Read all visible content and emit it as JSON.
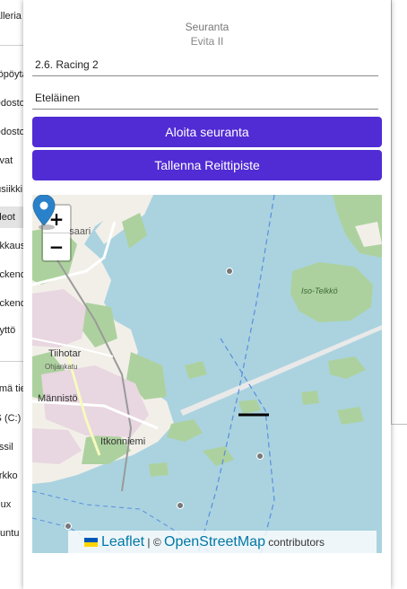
{
  "background": {
    "sidebar_items": [
      "Galleria",
      "Työpöytä",
      "Tiedostot",
      "Tiedostot",
      "Kuvat",
      "Musiikki",
      "Videot",
      "Pakkaus",
      "Backend",
      "Backend",
      "Käyttö",
      "Tämä tietokone",
      "OS (C:)",
      "Fossil",
      "Verkko",
      "Linux",
      "Ubuntu"
    ],
    "selected_index": 6
  },
  "dialog": {
    "title": "Seuranta",
    "subtitle": "Evita II",
    "race_field": {
      "value": "2.6. Racing 2"
    },
    "direction_field": {
      "value": "Eteläinen"
    },
    "start_button": "Aloita seuranta",
    "save_button": "Tallenna Reittipiste"
  },
  "map": {
    "zoom_in": "+",
    "zoom_out": "−",
    "labels": {
      "reposaari": "Reposaari",
      "tiilimaki": "Tiihotar",
      "mannisto": "Männistö",
      "itkonniemi": "Itkonniemi",
      "iso_telkko": "Iso-Telkkö",
      "street": "Ohjankatu"
    },
    "attribution": {
      "leaflet": "Leaflet",
      "separator": " | © ",
      "osm": "OpenStreetMap",
      "contributors": " contributors"
    },
    "colors": {
      "water": "#aad3df",
      "land": "#f2efe9",
      "forest": "#add19e",
      "urban": "#e8d6e0",
      "pin": "#2a81cb"
    }
  }
}
